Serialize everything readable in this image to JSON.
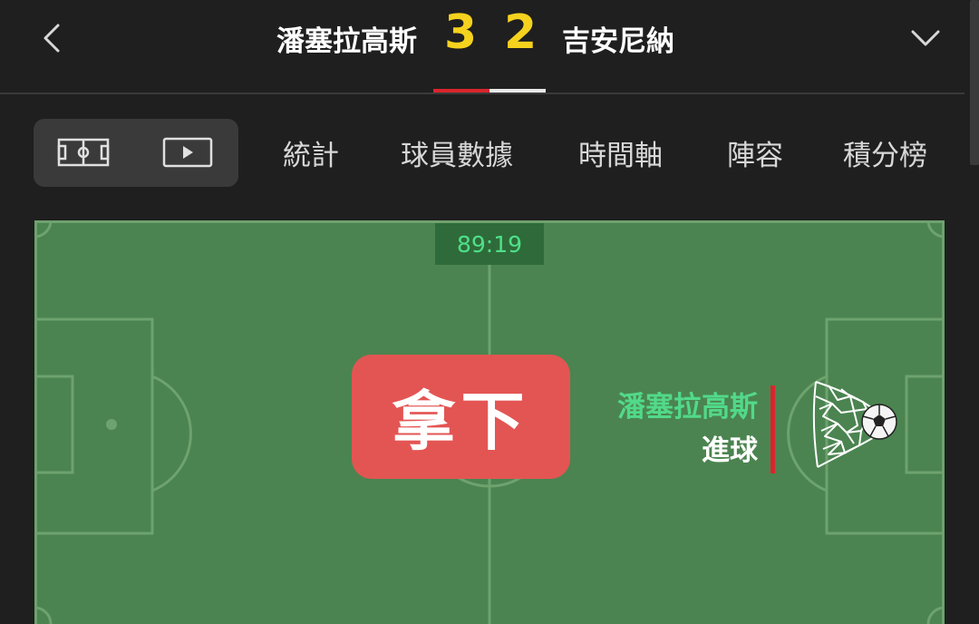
{
  "header": {
    "home_team": "潘塞拉高斯",
    "home_score": "3",
    "away_score": "2",
    "away_team": "吉安尼納",
    "back_icon": "chevron-left-icon",
    "expand_icon": "chevron-down-icon"
  },
  "tabs": {
    "view_toggle": [
      {
        "icon": "pitch-icon",
        "active": true
      },
      {
        "icon": "play-video-icon",
        "active": false
      }
    ],
    "items": [
      {
        "label": "統計"
      },
      {
        "label": "球員數據"
      },
      {
        "label": "時間軸"
      },
      {
        "label": "陣容"
      },
      {
        "label": "積分榜"
      }
    ]
  },
  "pitch": {
    "match_time": "89:19",
    "event_badge": "拿下",
    "event_team": "潘塞拉高斯",
    "event_type": "進球",
    "event_icon": "goal-net-icon"
  },
  "colors": {
    "background": "#1f1f1f",
    "score": "#f5d21d",
    "pitch": "#4b8450",
    "badge": "#e35553",
    "team_highlight": "#52d98a",
    "accent_red": "#d9252c"
  }
}
